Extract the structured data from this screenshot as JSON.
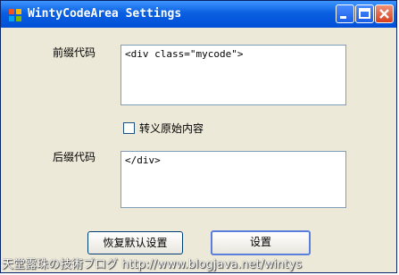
{
  "window": {
    "title": "WintyCodeArea Settings"
  },
  "form": {
    "prefix_label": "前缀代码",
    "prefix_value": "<div class=\"mycode\">",
    "escape_checkbox_label": "转义原始内容",
    "escape_checked": false,
    "suffix_label": "后缀代码",
    "suffix_value": "</div>"
  },
  "buttons": {
    "restore_default": "恢复默认设置",
    "apply": "设置"
  },
  "watermark": "天堂露珠の技術ブログ  http://www.blogjava.net/wintys"
}
